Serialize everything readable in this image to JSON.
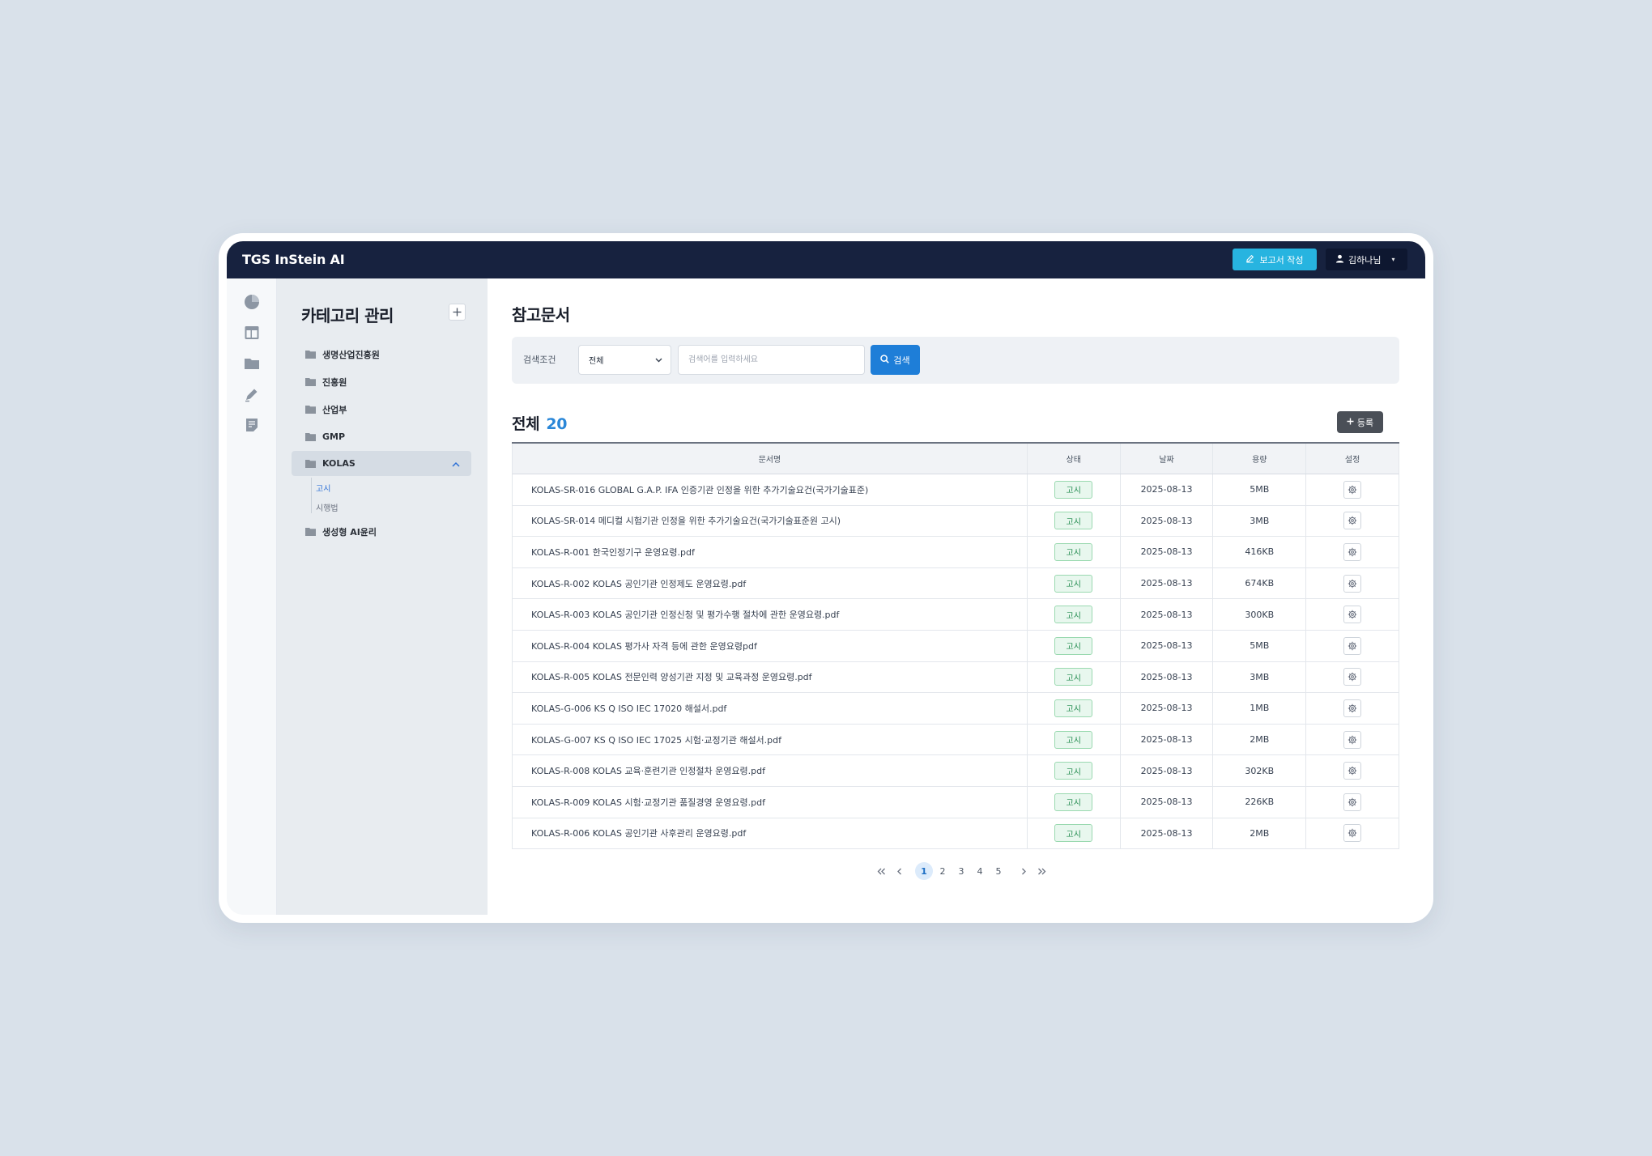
{
  "app": {
    "title": "TGS InStein AI"
  },
  "header": {
    "report_label": "보고서 작성",
    "user_name": "김하나님"
  },
  "rail": {
    "icons": [
      "pie-chart-icon",
      "layout-icon",
      "folder-icon",
      "pen-icon",
      "document-icon"
    ]
  },
  "category": {
    "title": "카테고리 관리",
    "items": [
      {
        "label": "생명산업진흥원"
      },
      {
        "label": "진흥원"
      },
      {
        "label": "산업부"
      },
      {
        "label": "GMP"
      },
      {
        "label": "KOLAS",
        "expanded": true,
        "children": [
          {
            "label": "고시",
            "active": true
          },
          {
            "label": "시행법"
          }
        ]
      },
      {
        "label": "생성형 AI윤리"
      }
    ]
  },
  "main": {
    "title": "참고문서",
    "search": {
      "label": "검색조건",
      "selected": "전체",
      "placeholder": "검색어를 입력하세요",
      "button": "검색"
    },
    "total_label": "전체",
    "total_count": "20",
    "register_label": "등록",
    "columns": [
      "문서명",
      "상태",
      "날짜",
      "용량",
      "설정"
    ],
    "rows": [
      {
        "name": "KOLAS-SR-016 GLOBAL G.A.P. IFA 인증기관 인정을 위한 추가기술요건(국가기술표준)",
        "status": "고시",
        "date": "2025-08-13",
        "size": "5MB"
      },
      {
        "name": "KOLAS-SR-014 메디컬 시험기관 인정을 위한 추가기술요건(국가기술표준원 고시)",
        "status": "고시",
        "date": "2025-08-13",
        "size": "3MB"
      },
      {
        "name": "KOLAS-R-001 한국인정기구 운영요령.pdf",
        "status": "고시",
        "date": "2025-08-13",
        "size": "416KB"
      },
      {
        "name": "KOLAS-R-002 KOLAS 공인기관 인정제도 운영요령.pdf",
        "status": "고시",
        "date": "2025-08-13",
        "size": "674KB"
      },
      {
        "name": "KOLAS-R-003 KOLAS 공인기관 인정신청 및 평가수행 절차에 관한 운영요령.pdf",
        "status": "고시",
        "date": "2025-08-13",
        "size": "300KB"
      },
      {
        "name": "KOLAS-R-004 KOLAS 평가사 자격 등에 관한 운영요령pdf",
        "status": "고시",
        "date": "2025-08-13",
        "size": "5MB"
      },
      {
        "name": "KOLAS-R-005 KOLAS 전문인력 양성기관 지정 및 교육과정 운영요령.pdf",
        "status": "고시",
        "date": "2025-08-13",
        "size": "3MB"
      },
      {
        "name": "KOLAS-G-006 KS Q ISO IEC 17020 해설서.pdf",
        "status": "고시",
        "date": "2025-08-13",
        "size": "1MB"
      },
      {
        "name": "KOLAS-G-007 KS Q ISO IEC 17025 시험·교정기관 해설서.pdf",
        "status": "고시",
        "date": "2025-08-13",
        "size": "2MB"
      },
      {
        "name": "KOLAS-R-008 KOLAS 교육·훈련기관 인정절차 운영요령.pdf",
        "status": "고시",
        "date": "2025-08-13",
        "size": "302KB"
      },
      {
        "name": "KOLAS-R-009 KOLAS 시험·교정기관 품질경영 운영요령.pdf",
        "status": "고시",
        "date": "2025-08-13",
        "size": "226KB"
      },
      {
        "name": "KOLAS-R-006 KOLAS 공인기관 사후관리 운영요령.pdf",
        "status": "고시",
        "date": "2025-08-13",
        "size": "2MB"
      }
    ],
    "pagination": {
      "pages": [
        "1",
        "2",
        "3",
        "4",
        "5"
      ],
      "current": "1"
    }
  },
  "colors": {
    "topbar": "#17223f",
    "accent": "#27b4e0",
    "primary": "#1e7ed8",
    "status_green": "#1f8a4c"
  }
}
